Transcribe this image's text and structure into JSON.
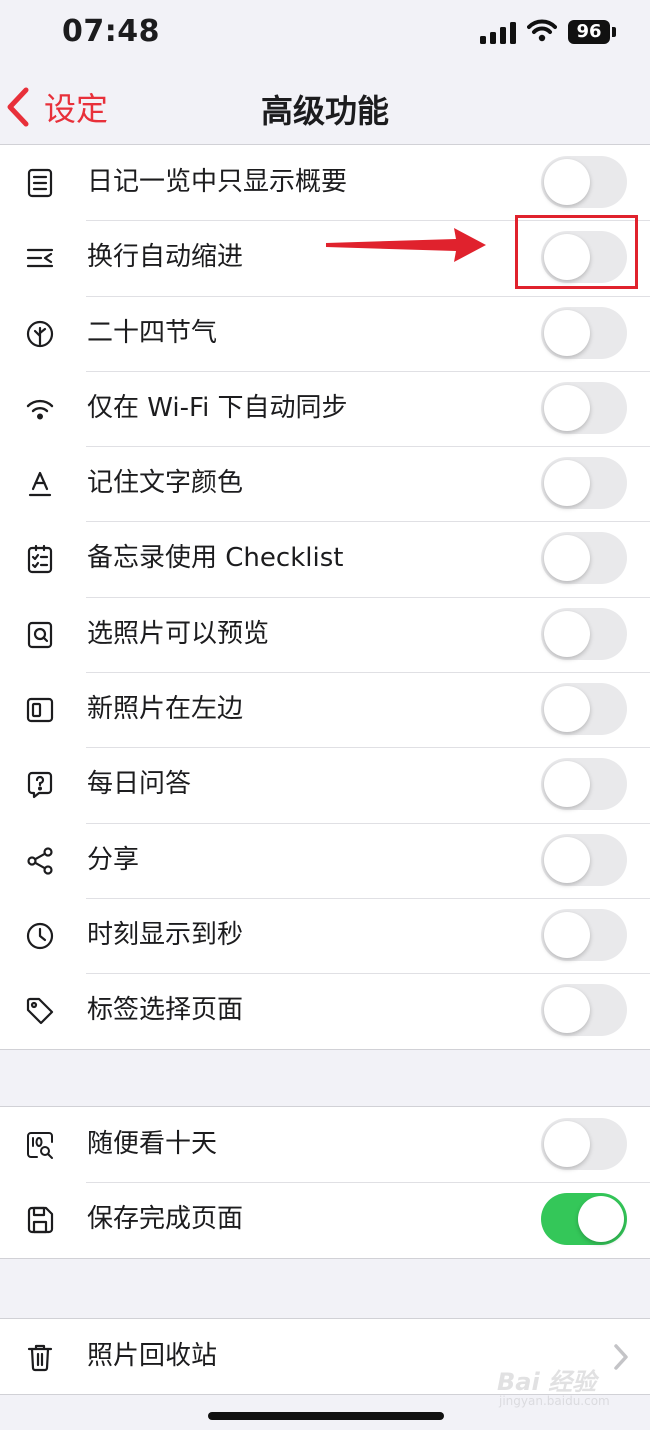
{
  "status_bar": {
    "time": "07:48",
    "battery": "96"
  },
  "nav": {
    "back_label": "设定",
    "title": "高级功能"
  },
  "group1": [
    {
      "label": "日记一览中只显示概要",
      "icon": "list-document-icon",
      "on": false
    },
    {
      "label": "换行自动缩进",
      "icon": "indent-icon",
      "on": false
    },
    {
      "label": "二十四节气",
      "icon": "leaf-icon",
      "on": false
    },
    {
      "label": "仅在 Wi-Fi 下自动同步",
      "icon": "wifi-icon",
      "on": false
    },
    {
      "label": "记住文字颜色",
      "icon": "text-color-icon",
      "on": false
    },
    {
      "label": "备忘录使用 Checklist",
      "icon": "checklist-icon",
      "on": false
    },
    {
      "label": "选照片可以预览",
      "icon": "photo-preview-icon",
      "on": false
    },
    {
      "label": "新照片在左边",
      "icon": "photo-left-icon",
      "on": false
    },
    {
      "label": "每日问答",
      "icon": "question-bubble-icon",
      "on": false
    },
    {
      "label": "分享",
      "icon": "share-icon",
      "on": false
    },
    {
      "label": "时刻显示到秒",
      "icon": "clock-icon",
      "on": false
    },
    {
      "label": "标签选择页面",
      "icon": "tag-icon",
      "on": false
    }
  ],
  "group2": [
    {
      "label": "随便看十天",
      "icon": "ten-days-search-icon",
      "on": false
    },
    {
      "label": "保存完成页面",
      "icon": "save-icon",
      "on": true
    }
  ],
  "group3": [
    {
      "label": "照片回收站",
      "icon": "trash-icon"
    }
  ],
  "watermark": {
    "text": "Bai 经验",
    "sub": "jingyan.baidu.com"
  },
  "colors": {
    "accent": "#e8303a",
    "toggle_on": "#34c759",
    "toggle_off": "#e9e9eb",
    "annotation": "#e0222d"
  }
}
